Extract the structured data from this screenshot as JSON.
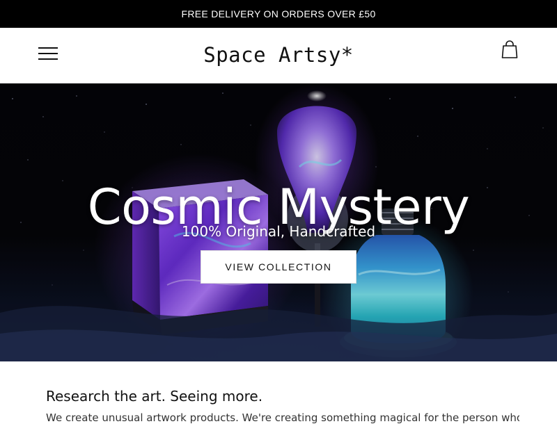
{
  "announcement": {
    "text": "FREE DELIVERY ON ORDERS OVER £50"
  },
  "header": {
    "logo": "Space Artsy*",
    "menu_icon": "hamburger-menu-icon",
    "cart_icon": "shopping-bag-icon"
  },
  "hero": {
    "title": "Cosmic Mystery",
    "subtitle": "100% Original, Handcrafted",
    "cta_label": "VIEW COLLECTION",
    "image_description_colors": {
      "purple": "#7a3cf0",
      "cyan": "#4fd6e8",
      "background": "#050509"
    }
  },
  "about": {
    "heading": "Research the art. Seeing more.",
    "body": "We create unusual artwork products. We're creating something magical for the person who"
  },
  "colors": {
    "announcement_bg": "#000000",
    "text": "#111111",
    "button_bg": "#ffffff"
  }
}
